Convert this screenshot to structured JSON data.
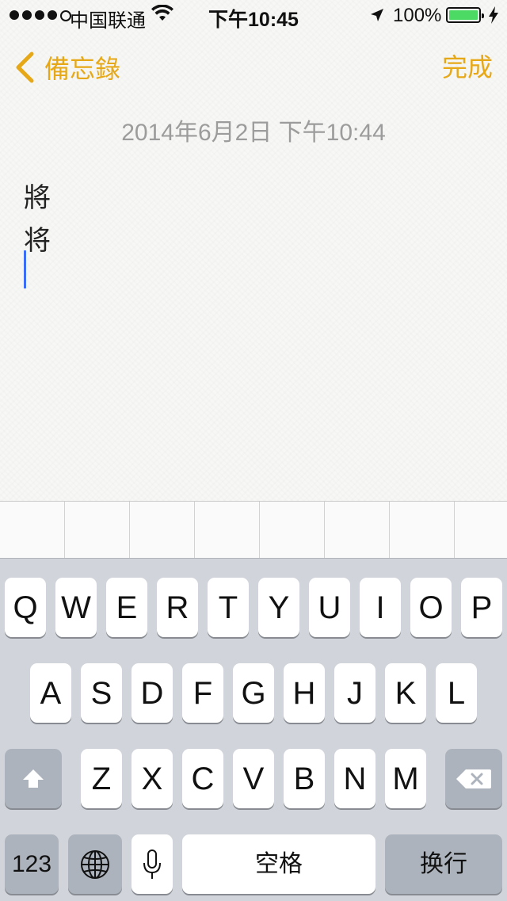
{
  "status_bar": {
    "carrier": "中国联通",
    "time": "下午10:45",
    "battery_percent": "100%",
    "battery_level": 1.0,
    "signal_bars": 4,
    "signal_max": 5
  },
  "nav": {
    "back_label": "備忘錄",
    "done_label": "完成",
    "accent_color": "#e6a817"
  },
  "note": {
    "date": "2014年6月2日 下午10:44",
    "lines": [
      "將",
      "将"
    ]
  },
  "keyboard": {
    "row1": [
      "Q",
      "W",
      "E",
      "R",
      "T",
      "Y",
      "U",
      "I",
      "O",
      "P"
    ],
    "row2": [
      "A",
      "S",
      "D",
      "F",
      "G",
      "H",
      "J",
      "K",
      "L"
    ],
    "row3": [
      "Z",
      "X",
      "C",
      "V",
      "B",
      "N",
      "M"
    ],
    "numbers_label": "123",
    "space_label": "空格",
    "return_label": "换行",
    "icons": {
      "shift": "shift-icon",
      "delete": "delete-icon",
      "globe": "globe-icon",
      "mic": "microphone-icon"
    }
  }
}
